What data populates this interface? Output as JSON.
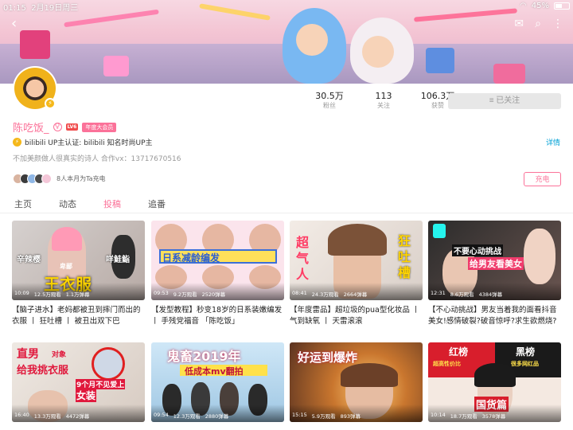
{
  "status_bar": {
    "time": "01:15",
    "date": "2月19日周三",
    "battery": "45%"
  },
  "header_icons": {
    "back": "back-arrow-icon",
    "mail": "mail-icon",
    "search": "search-icon",
    "more": "more-icon"
  },
  "profile": {
    "name": "陈吃饭_",
    "level": "LV6",
    "vip": "年度大会员",
    "stats": [
      {
        "value": "30.5万",
        "label": "粉丝"
      },
      {
        "value": "113",
        "label": "关注"
      },
      {
        "value": "106.3万",
        "label": "获赞"
      }
    ],
    "follow_label": "≡ 已关注",
    "verify": "bilibili  UP主认证:  bilibili  知名时尚UP主",
    "detail": "详情",
    "bio": "不加美颜做人很真实的诗人  合作vx：13717670516",
    "fans_charge": "8人本月为Ta充电",
    "charge_label": "充电"
  },
  "tabs": [
    "主页",
    "动态",
    "投稿",
    "追番"
  ],
  "active_tab": 2,
  "colors": {
    "brand_pink": "#fb7299",
    "link_blue": "#00a1d6"
  },
  "videos": [
    {
      "duration": "10:09",
      "views": "12.5万观看",
      "danmaku": "1.1万弹幕",
      "title": "【脑子进水】老妈都被丑到摔门而出的衣服 丨 狂吐槽 丨 被丑出双下巴",
      "overlay": [
        "辛辣樱",
        "卑鄙",
        "王衣服",
        "咩鮭鮨"
      ]
    },
    {
      "duration": "09:53",
      "views": "9.2万观看",
      "danmaku": "2520弹幕",
      "title": "【发型教程】秒变18岁的日系装嫩编发 丨 手残党福音 「陈吃饭」",
      "overlay": [
        "日系减龄编发"
      ]
    },
    {
      "duration": "08:41",
      "views": "24.3万观看",
      "danmaku": "2664弹幕",
      "title": "【年度雷品】超垃圾的pua型化妆品 丨 气到缺氧 丨 天雷滚滚",
      "overlay": [
        "超",
        "气",
        "人",
        "狂",
        "吐",
        "槽"
      ]
    },
    {
      "duration": "12:31",
      "views": "8.6万观看",
      "danmaku": "4384弹幕",
      "title": "【不心动挑战】男友当着我的面看抖音美女!感情破裂?破音惊呼?求生欲燃烧?",
      "overlay": [
        "不要心动挑战",
        "给男友看美女"
      ]
    },
    {
      "duration": "16:40",
      "views": "13.3万观看",
      "danmaku": "4472弹幕",
      "title": "",
      "overlay": [
        "直男",
        "对象",
        "给我挑衣服",
        "9个月不见爱上",
        "女装"
      ]
    },
    {
      "duration": "09:54",
      "views": "12.3万观看",
      "danmaku": "2880弹幕",
      "title": "",
      "overlay": [
        "鬼畜2019年",
        "低成本mv翻拍"
      ]
    },
    {
      "duration": "15:15",
      "views": "5.9万观看",
      "danmaku": "893弹幕",
      "title": "",
      "overlay": [
        "好运到爆炸"
      ]
    },
    {
      "duration": "10:14",
      "views": "18.7万观看",
      "danmaku": "3578弹幕",
      "title": "",
      "overlay": [
        "红榜",
        "黑榜",
        "超高性价比",
        "很多网红品",
        "国货篇"
      ]
    }
  ]
}
